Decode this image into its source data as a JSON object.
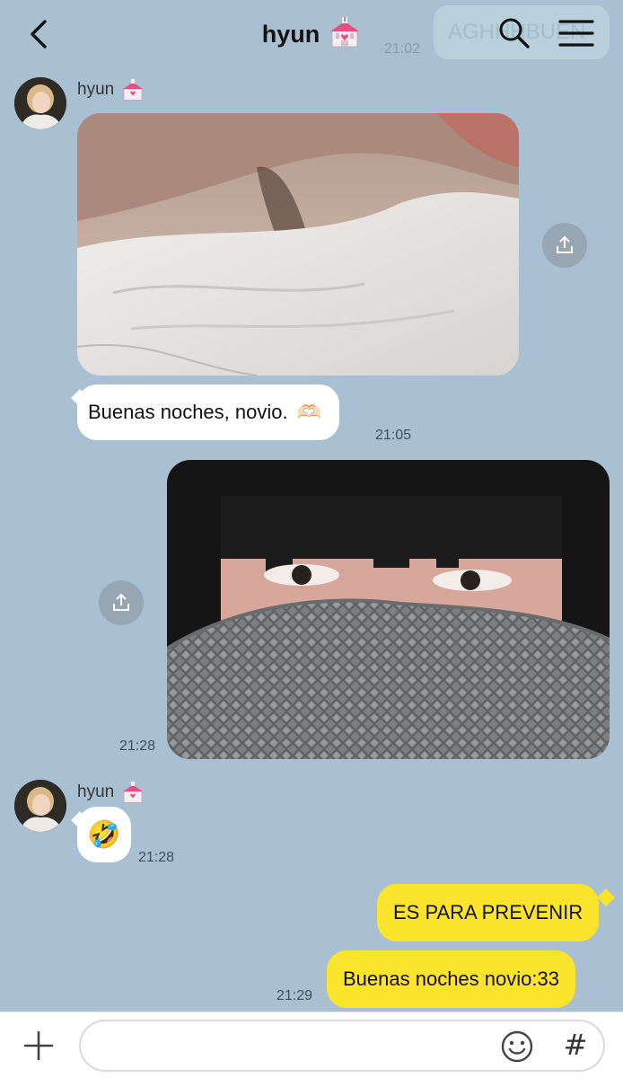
{
  "header": {
    "title": "hyun",
    "title_emoji": "💒",
    "back_icon": "chevron-left-icon",
    "search_icon": "search-icon",
    "menu_icon": "hamburger-menu-icon",
    "ghost_badge_text": "AGHHHBUEN",
    "ghost_time": "21:02"
  },
  "messages": [
    {
      "id": "m1",
      "type": "photo",
      "direction": "incoming",
      "sender": "hyun",
      "sender_emoji": "💒",
      "subject": "person lying in white bedding"
    },
    {
      "id": "m2",
      "type": "text",
      "direction": "incoming",
      "text": "Buenas noches, novio.",
      "emoji": "🫶🏻",
      "time": "21:05"
    },
    {
      "id": "m3",
      "type": "photo",
      "direction": "outgoing",
      "subject": "person peeking over grey blanket",
      "time": "21:28"
    },
    {
      "id": "m4",
      "type": "emoji",
      "direction": "incoming",
      "sender": "hyun",
      "sender_emoji": "💒",
      "text": "🤣",
      "time": "21:28"
    },
    {
      "id": "m5",
      "type": "text",
      "direction": "outgoing",
      "text": "ES PARA PREVENIR"
    },
    {
      "id": "m6",
      "type": "text",
      "direction": "outgoing",
      "text": "Buenas noches novio:33",
      "time": "21:29"
    }
  ],
  "input_bar": {
    "placeholder": "",
    "plus_icon": "plus-icon",
    "emoji_icon": "smiley-icon",
    "hashtag_label": "#"
  },
  "colors": {
    "chat_background": "#a9c0d3",
    "incoming_bubble": "#ffffff",
    "outgoing_bubble": "#fde42c",
    "share_button": "#96a6b3"
  }
}
